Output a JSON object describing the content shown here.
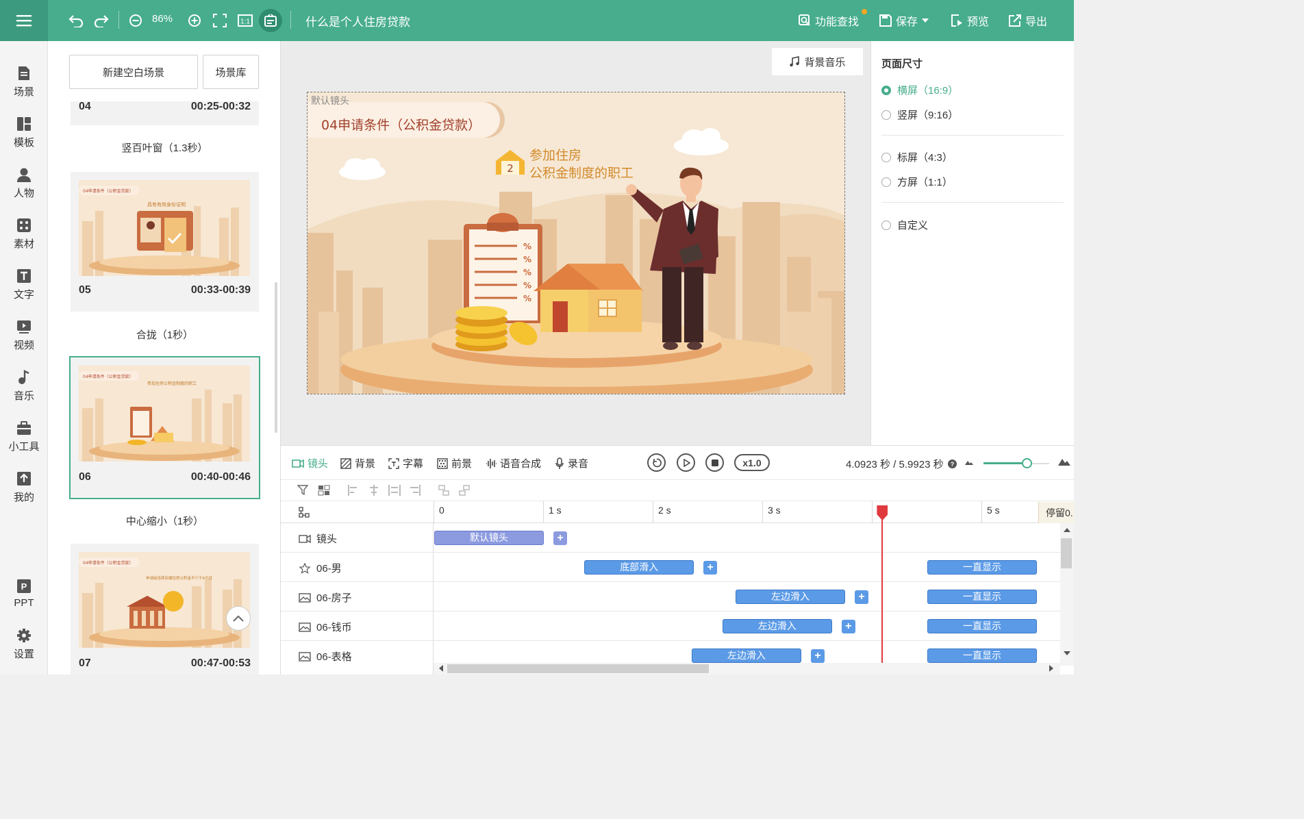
{
  "toolbar": {
    "zoom": "86%",
    "doc_title": "什么是个人住房贷款",
    "find": "功能查找",
    "save": "保存",
    "preview": "预览",
    "export": "导出"
  },
  "rail": [
    {
      "label": "场景",
      "icon": "scene-icon"
    },
    {
      "label": "模板",
      "icon": "template-icon"
    },
    {
      "label": "人物",
      "icon": "person-icon"
    },
    {
      "label": "素材",
      "icon": "material-icon"
    },
    {
      "label": "文字",
      "icon": "text-icon"
    },
    {
      "label": "视频",
      "icon": "video-icon"
    },
    {
      "label": "音乐",
      "icon": "music-icon"
    },
    {
      "label": "小工具",
      "icon": "toolbox-icon"
    },
    {
      "label": "我的",
      "icon": "upload-icon"
    },
    {
      "label": "PPT",
      "icon": "ppt-icon"
    },
    {
      "label": "设置",
      "icon": "gear-icon"
    }
  ],
  "scenes_panel": {
    "new_blank": "新建空白场景",
    "library": "场景库",
    "scenes": [
      {
        "num": "04",
        "time": "00:25-00:32",
        "transition": "竖百叶窗（1.3秒）"
      },
      {
        "num": "05",
        "time": "00:33-00:39",
        "transition": "合拢（1秒）",
        "thumb_title": "04申请条件（公积金贷款）",
        "thumb_text": "具有有效身份证明"
      },
      {
        "num": "06",
        "time": "00:40-00:46",
        "transition": "中心缩小（1秒）",
        "thumb_title": "04申请条件（公积金贷款）",
        "thumb_text": "参加住房公积金制度的职工"
      },
      {
        "num": "07",
        "time": "00:47-00:53",
        "thumb_title": "04申请条件（公积金贷款）",
        "thumb_text": "申请前连续存缴住房公积金不少于6个月"
      }
    ]
  },
  "canvas": {
    "bg_music": "背景音乐",
    "lens_label": "默认镜头",
    "slide_title": "04申请条件（公积金贷款）",
    "badge_num": "2",
    "headline_1": "参加住房",
    "headline_2": "公积金制度的职工"
  },
  "page_size": {
    "title": "页面尺寸",
    "options": [
      "横屏（16:9）",
      "竖屏（9:16）",
      "标屏（4:3）",
      "方屏（1:1）",
      "自定义"
    ],
    "selected": "横屏（16:9）"
  },
  "timeline": {
    "tabs": [
      "镜头",
      "背景",
      "字幕",
      "前景",
      "语音合成",
      "录音"
    ],
    "speed": "x1.0",
    "time": "4.0923 秒 / 5.9923 秒",
    "zoom_level": 0.67,
    "ticks": [
      "0",
      "1 s",
      "2 s",
      "3 s",
      "",
      "5 s"
    ],
    "stay_label": "停留0.",
    "playhead_seconds": 4.09,
    "tracks": [
      {
        "name": "镜头",
        "icon": "camera-icon",
        "blocks": [
          {
            "label": "默认镜头",
            "start": 0,
            "end": 1
          }
        ]
      },
      {
        "name": "06-男",
        "icon": "star-icon",
        "blocks": [
          {
            "label": "底部滑入",
            "start": 1.37,
            "end": 2.37
          },
          {
            "label": "一直显示",
            "start": 4.5,
            "end": 5.5
          }
        ]
      },
      {
        "name": "06-房子",
        "icon": "image-icon",
        "blocks": [
          {
            "label": "左边滑入",
            "start": 2.75,
            "end": 3.75
          },
          {
            "label": "一直显示",
            "start": 4.5,
            "end": 5.5
          }
        ]
      },
      {
        "name": "06-钱币",
        "icon": "image-icon",
        "blocks": [
          {
            "label": "左边滑入",
            "start": 2.63,
            "end": 3.63
          },
          {
            "label": "一直显示",
            "start": 4.5,
            "end": 5.5
          }
        ]
      },
      {
        "name": "06-表格",
        "icon": "image-icon",
        "blocks": [
          {
            "label": "左边滑入",
            "start": 2.35,
            "end": 3.35
          },
          {
            "label": "一直显示",
            "start": 4.5,
            "end": 5.5
          }
        ]
      }
    ]
  },
  "colors": {
    "accent": "#47ad8d",
    "block": "#5b9ae6",
    "lens_block": "#8c9be0",
    "playhead": "#e0393e"
  }
}
